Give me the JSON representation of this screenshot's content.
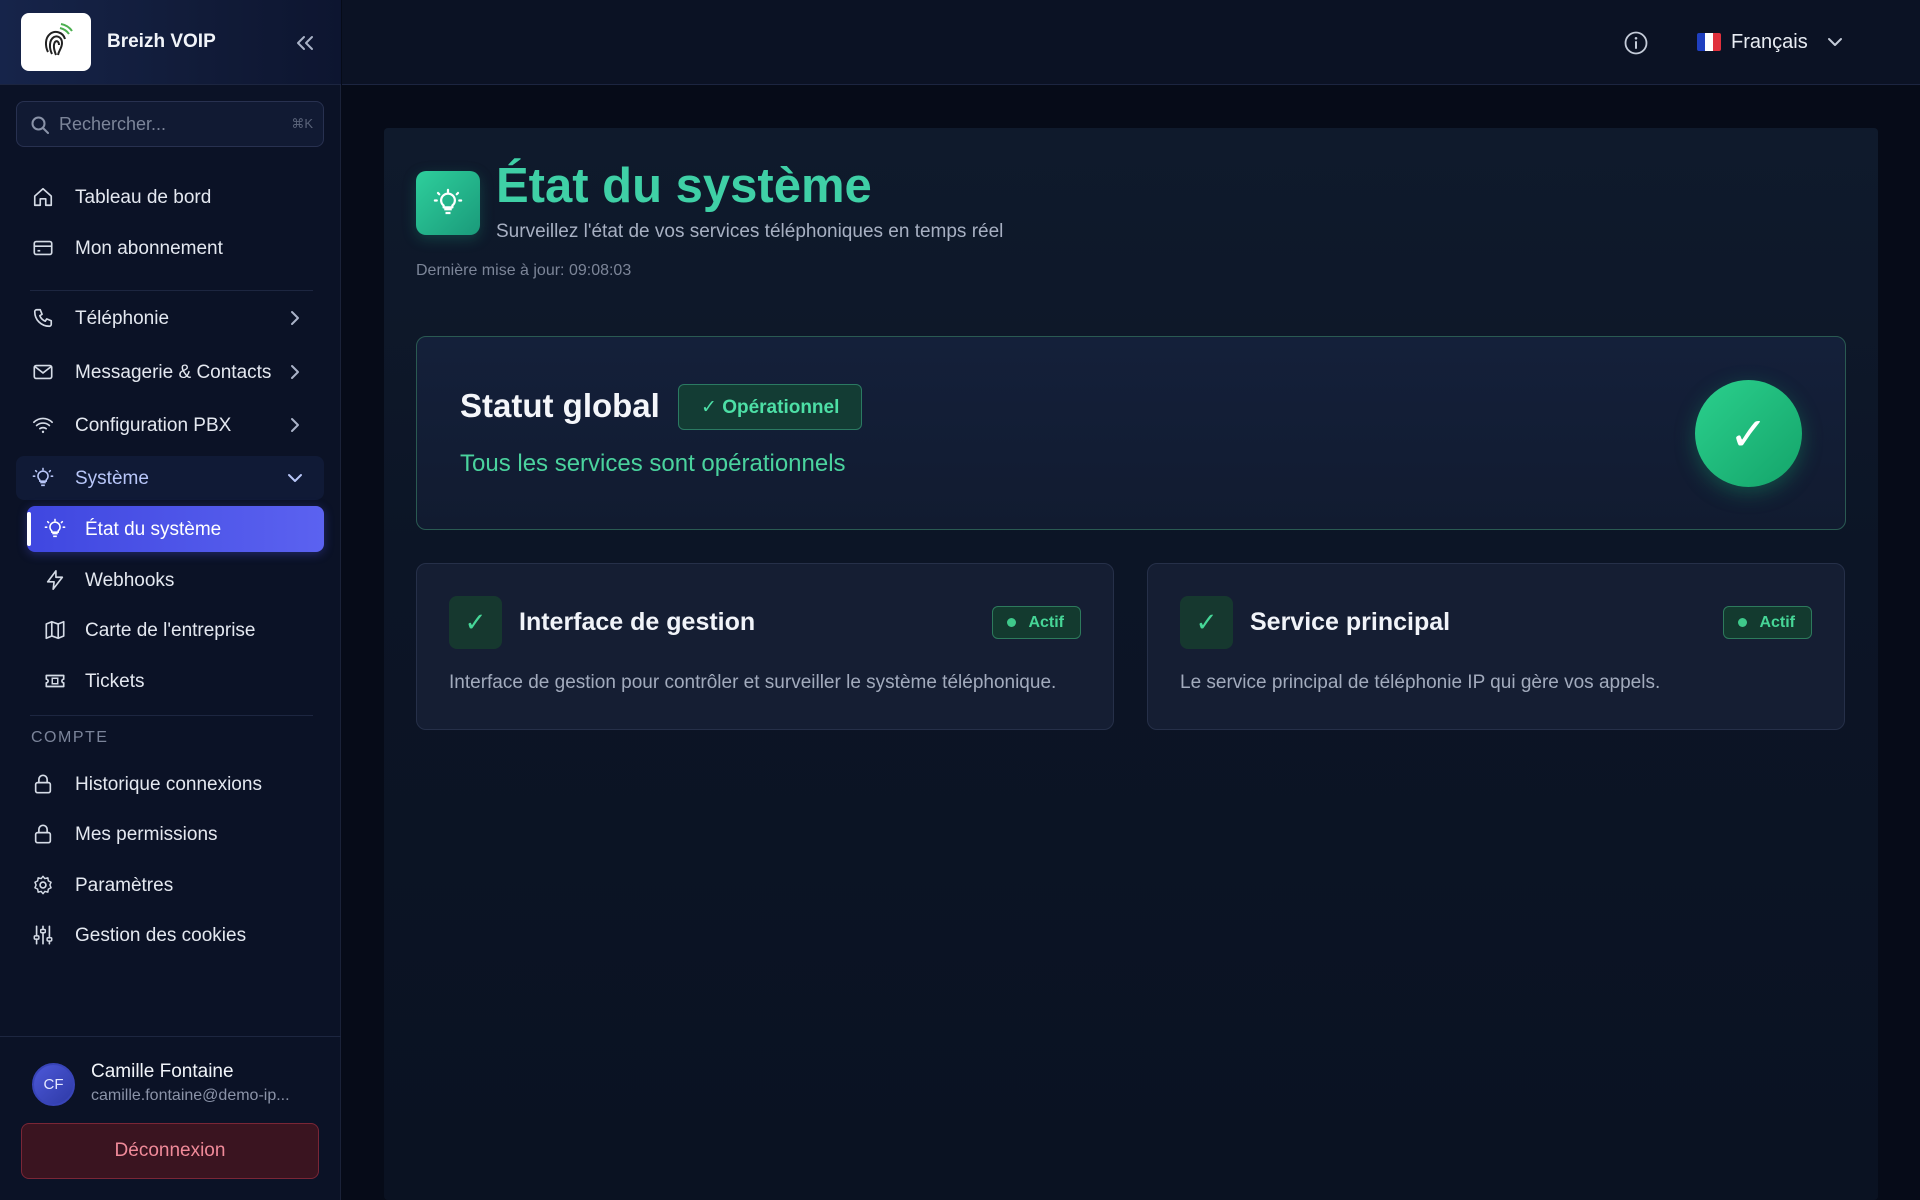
{
  "brand": {
    "name": "Breizh VOIP",
    "logo_icon": "fingerprint-logo"
  },
  "search": {
    "placeholder": "Rechercher...",
    "shortcut": "⌘K"
  },
  "sidebar": {
    "primary": [
      {
        "label": "Tableau de bord",
        "icon": "home-icon"
      },
      {
        "label": "Mon abonnement",
        "icon": "credit-card-icon"
      }
    ],
    "groups": [
      {
        "label": "Téléphonie",
        "icon": "phone-icon",
        "expanded": false
      },
      {
        "label": "Messagerie & Contacts",
        "icon": "mail-icon",
        "expanded": false
      },
      {
        "label": "Configuration PBX",
        "icon": "wifi-icon",
        "expanded": false
      },
      {
        "label": "Système",
        "icon": "lightbulb-icon",
        "expanded": true
      }
    ],
    "system_items": [
      {
        "label": "État du système",
        "icon": "lightbulb-icon",
        "active": true
      },
      {
        "label": "Webhooks",
        "icon": "lightning-icon",
        "active": false
      },
      {
        "label": "Carte de l'entreprise",
        "icon": "map-icon",
        "active": false
      },
      {
        "label": "Tickets",
        "icon": "ticket-icon",
        "active": false
      }
    ],
    "account_section_title": "COMPTE",
    "account_items": [
      {
        "label": "Historique connexions",
        "icon": "lock-icon"
      },
      {
        "label": "Mes permissions",
        "icon": "lock-icon"
      },
      {
        "label": "Paramètres",
        "icon": "gear-icon"
      },
      {
        "label": "Gestion des cookies",
        "icon": "sliders-icon"
      }
    ]
  },
  "user": {
    "initials": "CF",
    "name": "Camille Fontaine",
    "email": "camille.fontaine@demo-ip...",
    "logout_label": "Déconnexion"
  },
  "topbar": {
    "language": "Français",
    "flag_colors": [
      "#1f3fbf",
      "#ffffff",
      "#e0303c"
    ]
  },
  "page": {
    "title": "État du système",
    "subtitle": "Surveillez l'état de vos services téléphoniques en temps réel",
    "last_update": "Dernière mise à jour: 09:08:03"
  },
  "global_status": {
    "title": "Statut global",
    "badge": "✓ Opérationnel",
    "description": "Tous les services sont opérationnels",
    "check": "✓"
  },
  "services": [
    {
      "name": "Interface de gestion",
      "status": "Actif",
      "description": "Interface de gestion pour contrôler et surveiller le système téléphonique.",
      "check": "✓"
    },
    {
      "name": "Service principal",
      "status": "Actif",
      "description": "Le service principal de téléphonie IP qui gère vos appels.",
      "check": "✓"
    }
  ],
  "colors": {
    "accent_green": "#3fd0a6",
    "active_nav": "#4f56ea",
    "status_green": "#46d697",
    "logout_red": "#f08a99"
  }
}
